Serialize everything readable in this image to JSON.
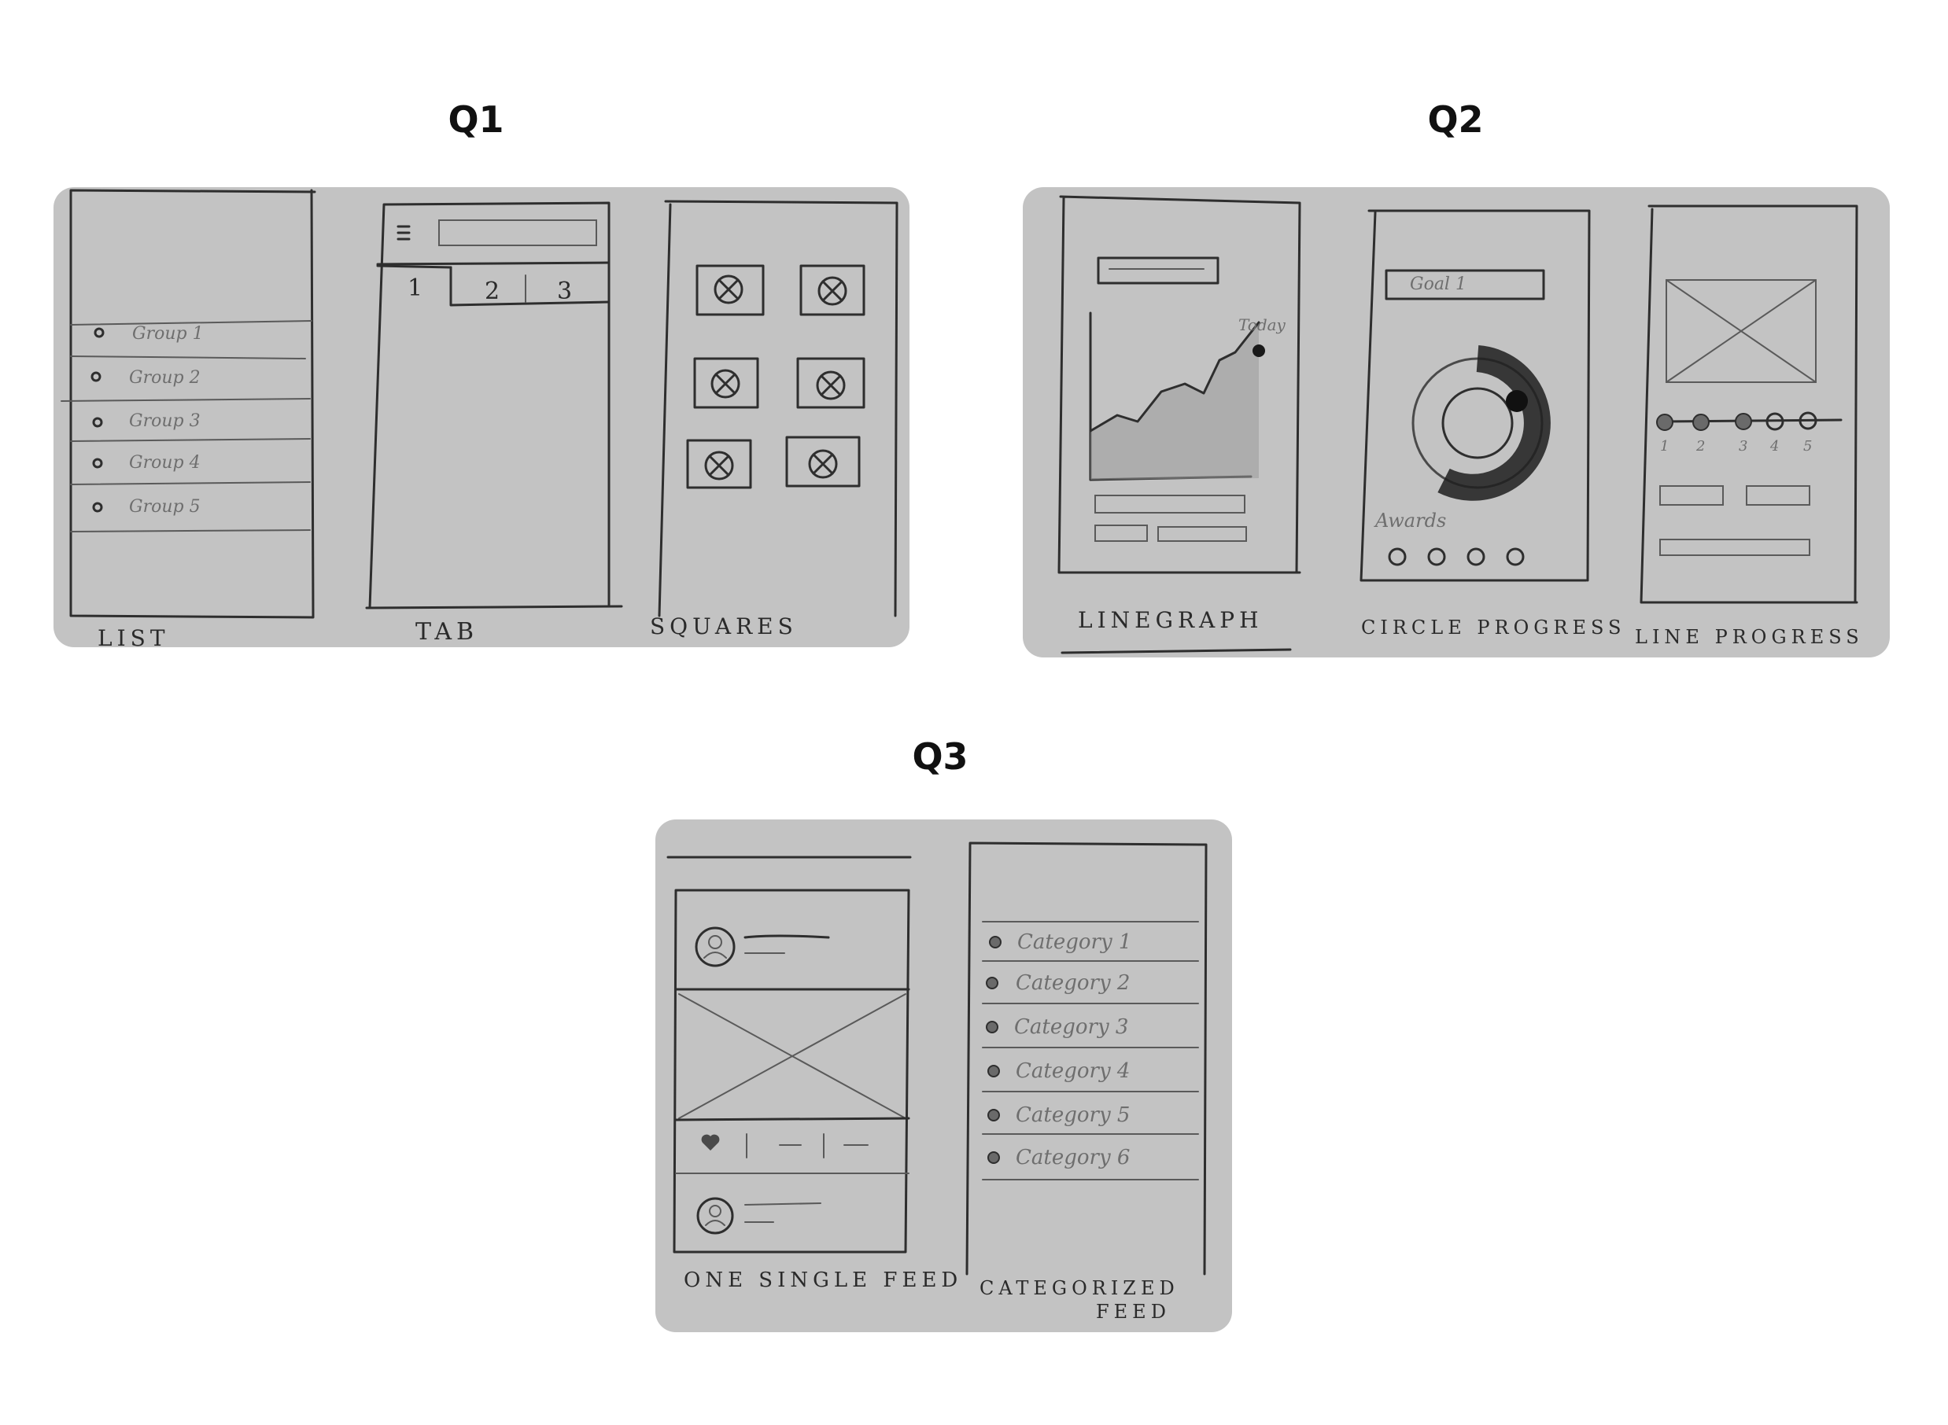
{
  "questions": [
    {
      "id": "q1",
      "title": "Q1",
      "screens": [
        {
          "label": "LIST",
          "items": [
            "Group 1",
            "Group 2",
            "Group 3",
            "Group 4",
            "Group 5"
          ]
        },
        {
          "label": "TAB",
          "tabs": [
            "1",
            "2",
            "3"
          ]
        },
        {
          "label": "SQUARES"
        }
      ]
    },
    {
      "id": "q2",
      "title": "Q2",
      "screens": [
        {
          "label": "LINEGRAPH",
          "annotation": "Today"
        },
        {
          "label": "CIRCLE PROGRESS",
          "field": "Goal 1",
          "section": "Awards"
        },
        {
          "label": "LINE PROGRESS",
          "steps": [
            "1",
            "2",
            "3",
            "4",
            "5"
          ]
        }
      ]
    },
    {
      "id": "q3",
      "title": "Q3",
      "screens": [
        {
          "label": "ONE SINGLE FEED"
        },
        {
          "label_line1": "CATEGORIZED",
          "label_line2": "FEED",
          "items": [
            "Category 1",
            "Category 2",
            "Category 3",
            "Category 4",
            "Category 5",
            "Category 6"
          ]
        }
      ]
    }
  ]
}
